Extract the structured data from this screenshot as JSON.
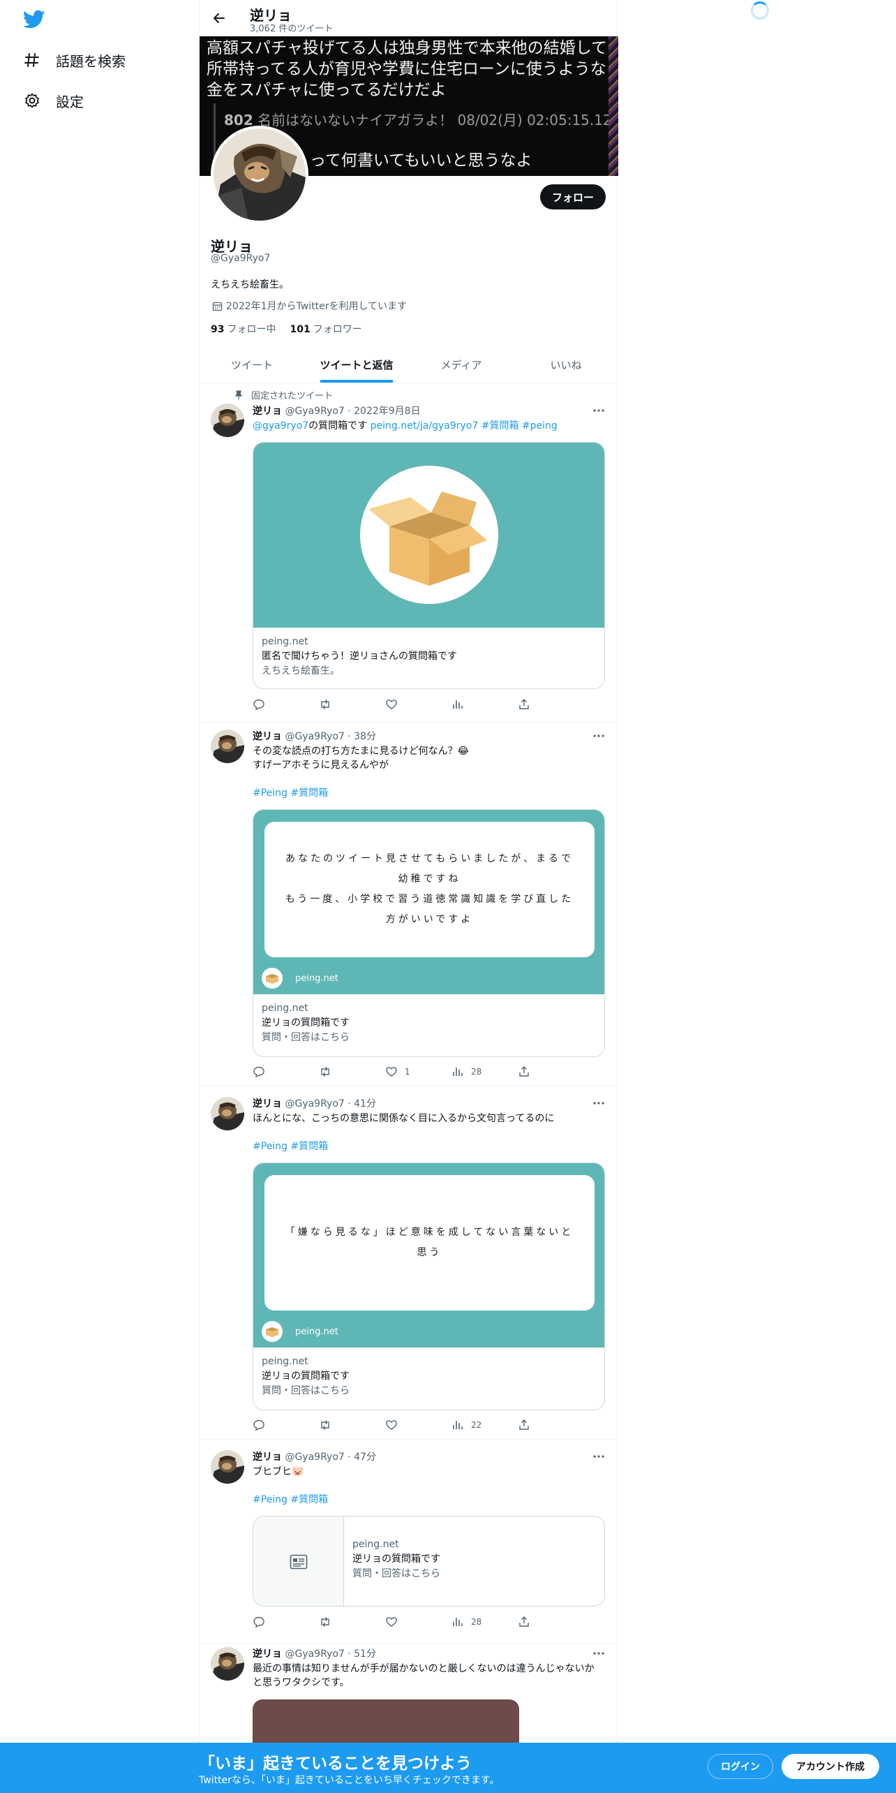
{
  "nav": {
    "logo": "twitter-bird-icon",
    "items": [
      {
        "icon": "hashtag-icon",
        "label": "話題を検索"
      },
      {
        "icon": "gear-icon",
        "label": "設定"
      }
    ]
  },
  "header": {
    "name": "逆リョ",
    "tweet_count": "3,062 件のツイート"
  },
  "banner": {
    "text": "高額スパチャ投げてる人は独身男性で本来他の結婚して所帯持ってる人が育児や学費に住宅ローンに使うような金をスパチャに使ってるだけだよ",
    "quote_no": "802",
    "quote_line": "名前はないないナイアガラよ！ 08/02(月) 02:05:15.12",
    "quote_text": "って何書いてもいいと思うなよ"
  },
  "profile": {
    "follow_label": "フォロー",
    "name": "逆リョ",
    "handle": "@Gya9Ryo7",
    "bio": "えちえち絵畜生。",
    "joined": "2022年1月からTwitterを利用しています",
    "following_count": "93",
    "following_label": "フォロー中",
    "followers_count": "101",
    "followers_label": "フォロワー"
  },
  "tabs": [
    {
      "label": "ツイート",
      "active": false
    },
    {
      "label": "ツイートと返信",
      "active": true
    },
    {
      "label": "メディア",
      "active": false
    },
    {
      "label": "いいね",
      "active": false
    }
  ],
  "pinned_label": "固定されたツイート",
  "tweets": [
    {
      "name": "逆リョ",
      "meta": "@Gya9Ryo7 · 2022年9月8日",
      "mention": "@gya9ryo7",
      "text_mid": "の質問箱です",
      "links": "peing.net/ja/gya9ryo7 #質問箱 #peing",
      "card": {
        "domain": "peing.net",
        "title": "匿名で聞けちゃう！逆リョさんの質問箱です",
        "desc": "えちえち絵畜生。"
      },
      "actions": {
        "reply": "",
        "retweet": "",
        "like": "",
        "views": ""
      }
    },
    {
      "name": "逆リョ",
      "meta": "@Gya9Ryo7 · 38分",
      "line1": "その変な読点の打ち方たまに見るけど何なん？😂",
      "line2": "すげーアホそうに見えるんやが",
      "tags": "#Peing #質問箱",
      "quote": "あなたのツイート見させてもらいましたが、まるで幼稚ですね\nもう一度、小学校で習う道徳常識知識を学び直した方がいいですよ",
      "quote_domain": "peing.net",
      "card": {
        "domain": "peing.net",
        "title": "逆リョの質問箱です",
        "desc": "質問・回答はこちら"
      },
      "actions": {
        "reply": "",
        "retweet": "",
        "like": "1",
        "views": "28"
      }
    },
    {
      "name": "逆リョ",
      "meta": "@Gya9Ryo7 · 41分",
      "line1": "ほんとにな、こっちの意思に関係なく目に入るから文句言ってるのに",
      "tags": "#Peing #質問箱",
      "quote": "「嫌なら見るな」ほど意味を成してない言葉ないと思う",
      "quote_domain": "peing.net",
      "card": {
        "domain": "peing.net",
        "title": "逆リョの質問箱です",
        "desc": "質問・回答はこちら"
      },
      "actions": {
        "reply": "",
        "retweet": "",
        "like": "",
        "views": "22"
      }
    },
    {
      "name": "逆リョ",
      "meta": "@Gya9Ryo7 · 47分",
      "line1": "ブヒブヒ🐷",
      "tags": "#Peing #質問箱",
      "card": {
        "domain": "peing.net",
        "title": "逆リョの質問箱です",
        "desc": "質問・回答はこちら"
      },
      "actions": {
        "reply": "",
        "retweet": "",
        "like": "",
        "views": "28"
      }
    },
    {
      "name": "逆リョ",
      "meta": "@Gya9Ryo7 · 51分",
      "line1": "最近の事情は知りませんが手が届かないのと厳しくないのは違うんじゃないかと思うワタクシです。"
    }
  ],
  "bottom": {
    "title": "「いま」起きていることを見つけよう",
    "subtitle": "Twitterなら、「いま」起きていることをいち早くチェックできます。",
    "login": "ログイン",
    "signup": "アカウント作成"
  }
}
